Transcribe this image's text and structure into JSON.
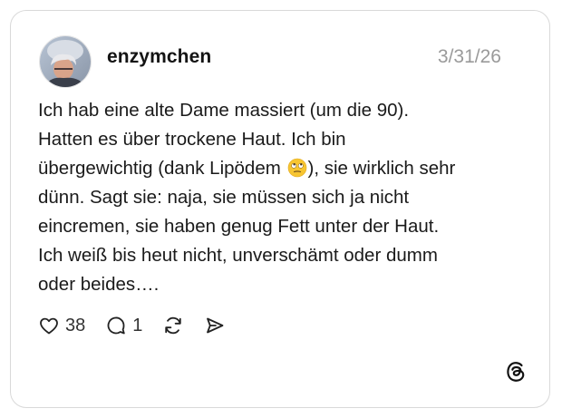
{
  "post": {
    "username": "enzymchen",
    "date": "3/31/26",
    "lines": [
      "Ich hab eine alte Dame massiert (um die 90).",
      "Hatten es über trockene Haut. Ich bin",
      "übergewichtig (dank Lipödem ",
      "), sie wirklich sehr",
      "dünn. Sagt sie: naja, sie müssen sich ja nicht",
      "eincremen, sie haben genug Fett unter der Haut.",
      "Ich weiß bis heut nicht, unverschämt oder dumm",
      "oder beides…."
    ],
    "emoji": "eye-roll-emoji"
  },
  "actions": {
    "likes": "38",
    "replies": "1"
  },
  "icons": {
    "like": "heart-icon",
    "reply": "speech-bubble-icon",
    "repost": "repost-icon",
    "share": "send-icon",
    "brand": "threads-logo-icon"
  },
  "colors": {
    "border": "#d9d9d9",
    "date": "#9a9a9a",
    "text": "#1a1a1a"
  }
}
